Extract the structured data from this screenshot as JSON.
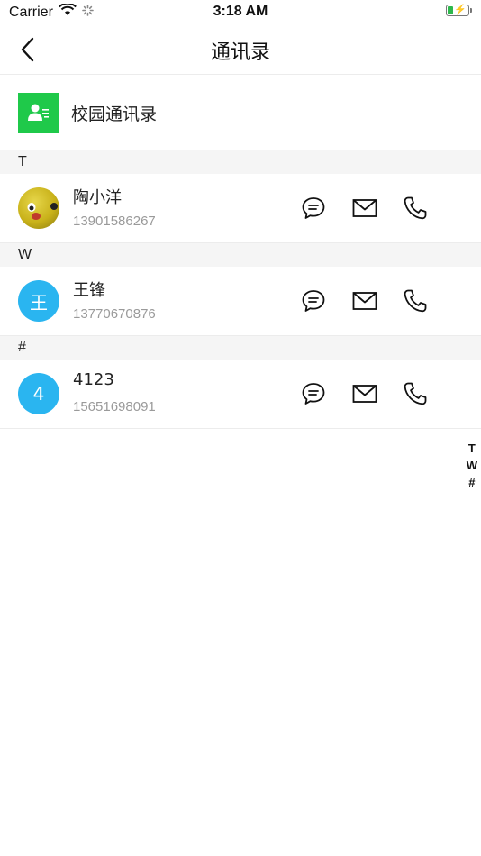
{
  "status_bar": {
    "carrier": "Carrier",
    "time": "3:18 AM",
    "battery_color": "#2db84d"
  },
  "nav": {
    "title": "通讯录",
    "back_icon": "chevron-left-icon"
  },
  "campus": {
    "label": "校园通讯录",
    "icon": "contact-card-icon",
    "icon_bg": "#1fc94a"
  },
  "sections": [
    {
      "letter": "T",
      "contacts": [
        {
          "name": "陶小洋",
          "phone": "13901586267",
          "avatar_type": "photo",
          "avatar_text": ""
        }
      ]
    },
    {
      "letter": "W",
      "contacts": [
        {
          "name": "王锋",
          "phone": "13770670876",
          "avatar_type": "initial",
          "avatar_text": "王"
        }
      ]
    },
    {
      "letter": "#",
      "contacts": [
        {
          "name": "4123",
          "phone": "15651698091",
          "avatar_type": "initial",
          "avatar_text": "4"
        }
      ]
    }
  ],
  "actions": {
    "message_icon": "message-bubble-icon",
    "mail_icon": "mail-icon",
    "call_icon": "phone-icon"
  },
  "index_letters": [
    "T",
    "W",
    "#"
  ],
  "colors": {
    "avatar_blue": "#2ab5f0",
    "section_bg": "#f5f5f5",
    "phone_text": "#9a9a9a"
  }
}
